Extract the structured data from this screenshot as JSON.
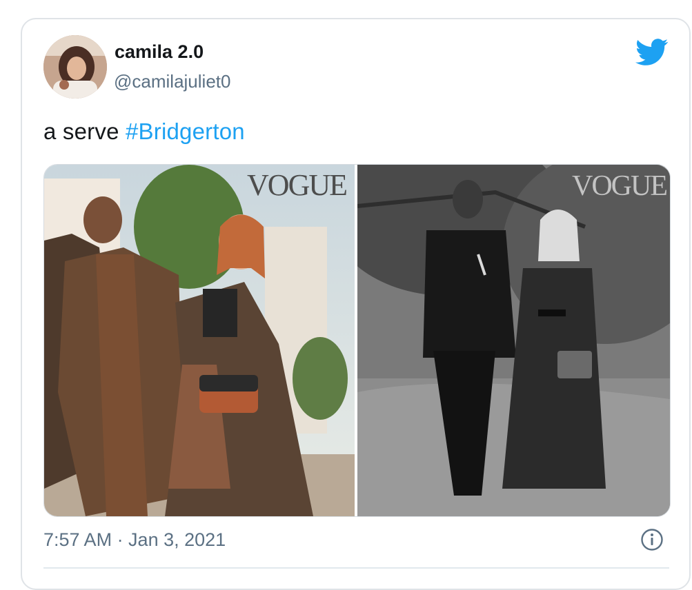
{
  "tweet": {
    "display_name": "camila 2.0",
    "handle": "@camilajuliet0",
    "text_plain": "a serve ",
    "hashtag": "#Bridgerton",
    "timestamp": "7:57 AM · Jan 3, 2021"
  },
  "media": {
    "left_logo": "VOGUE",
    "right_logo": "VOGUE"
  },
  "colors": {
    "link": "#1da1f2",
    "secondary_text": "#5b7083",
    "primary_text": "#14171a",
    "border": "#dfe3e7"
  },
  "icons": {
    "brand": "twitter-bird-icon",
    "info": "info-icon"
  }
}
